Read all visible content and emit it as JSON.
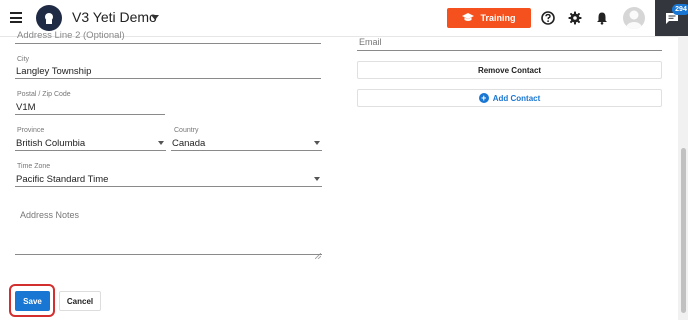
{
  "header": {
    "app_title": "V3 Yeti Demo",
    "training_label": "Training",
    "chat_count": "294"
  },
  "form": {
    "address_line2": {
      "placeholder": "Address Line 2 (Optional)"
    },
    "city": {
      "label": "City",
      "value": "Langley Township"
    },
    "postal": {
      "label": "Postal / Zip Code",
      "value": "V1M"
    },
    "province": {
      "label": "Province",
      "value": "British Columbia"
    },
    "country": {
      "label": "Country",
      "value": "Canada"
    },
    "timezone": {
      "label": "Time Zone",
      "value": "Pacific Standard Time"
    },
    "notes": {
      "label": "Address Notes",
      "value": ""
    }
  },
  "contact": {
    "email_label": "Email",
    "remove_label": "Remove Contact",
    "add_label": "Add Contact"
  },
  "actions": {
    "save_label": "Save",
    "cancel_label": "Cancel"
  },
  "colors": {
    "accent": "#1976d2",
    "training": "#f4511e",
    "highlight": "#d32f2f",
    "chat_panel": "#33373d"
  }
}
